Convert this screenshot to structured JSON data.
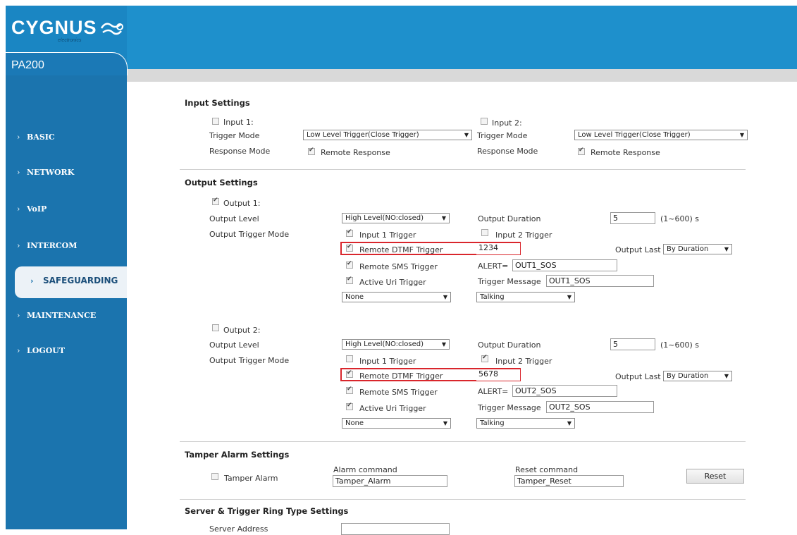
{
  "brand": {
    "logo": "CYGNUS",
    "logo_sub": "electronics",
    "model": "PA200",
    "colors": {
      "header": "#1e90cc",
      "sidebar": "#1b74ae",
      "highlight": "#d9262c"
    }
  },
  "nav": {
    "items": [
      {
        "label": "BASIC"
      },
      {
        "label": "NETWORK"
      },
      {
        "label": "VoIP"
      },
      {
        "label": "INTERCOM"
      },
      {
        "label": "SAFEGUARDING"
      },
      {
        "label": "MAINTENANCE"
      },
      {
        "label": "LOGOUT"
      }
    ],
    "chevron": "›",
    "active_chevron": "›"
  },
  "input_settings": {
    "title": "Input Settings",
    "inputs": [
      {
        "label": "Input 1:",
        "checked": false,
        "trigger_mode_label": "Trigger Mode",
        "trigger_mode": "Low Level Trigger(Close Trigger)",
        "response_mode_label": "Response Mode",
        "response": "Remote Response",
        "response_checked": true
      },
      {
        "label": "Input 2:",
        "checked": false,
        "trigger_mode_label": "Trigger Mode",
        "trigger_mode": "Low Level Trigger(Close Trigger)",
        "response_mode_label": "Response Mode",
        "response": "Remote Response",
        "response_checked": true
      }
    ]
  },
  "output_settings": {
    "title": "Output Settings",
    "outputs": [
      {
        "label": "Output 1:",
        "checked": true,
        "level_label": "Output Level",
        "level": "High Level(NO:closed)",
        "duration_label": "Output Duration",
        "duration": "5",
        "duration_range": "(1~600) s",
        "trigger_mode_label": "Output Trigger Mode",
        "input1_trigger": "Input 1 Trigger",
        "input1_checked": true,
        "input2_trigger": "Input 2 Trigger",
        "input2_checked": false,
        "dtmf_trigger": "Remote DTMF Trigger",
        "dtmf_value": "1234",
        "output_last_label": "Output Last",
        "output_last": "By Duration",
        "sms_trigger": "Remote SMS Trigger",
        "alert_label": "ALERT=",
        "alert_value": "OUT1_SOS",
        "uri_trigger": "Active Uri Trigger",
        "trigger_message_label": "Trigger Message",
        "trigger_message": "OUT1_SOS",
        "uri_select": "None",
        "state_select": "Talking"
      },
      {
        "label": "Output 2:",
        "checked": false,
        "level_label": "Output Level",
        "level": "High Level(NO:closed)",
        "duration_label": "Output Duration",
        "duration": "5",
        "duration_range": "(1~600) s",
        "trigger_mode_label": "Output Trigger Mode",
        "input1_trigger": "Input 1 Trigger",
        "input1_checked": false,
        "input2_trigger": "Input 2 Trigger",
        "input2_checked": true,
        "dtmf_trigger": "Remote DTMF Trigger",
        "dtmf_value": "5678",
        "output_last_label": "Output Last",
        "output_last": "By Duration",
        "sms_trigger": "Remote SMS Trigger",
        "alert_label": "ALERT=",
        "alert_value": "OUT2_SOS",
        "uri_trigger": "Active Uri Trigger",
        "trigger_message_label": "Trigger Message",
        "trigger_message": "OUT2_SOS",
        "uri_select": "None",
        "state_select": "Talking"
      }
    ]
  },
  "tamper": {
    "title": "Tamper Alarm Settings",
    "checkbox_label": "Tamper Alarm",
    "checked": false,
    "alarm_command_label": "Alarm command",
    "alarm_command": "Tamper_Alarm",
    "reset_command_label": "Reset command",
    "reset_command": "Tamper_Reset",
    "reset_button": "Reset"
  },
  "server": {
    "title": "Server & Trigger Ring Type Settings",
    "address_label": "Server Address"
  }
}
